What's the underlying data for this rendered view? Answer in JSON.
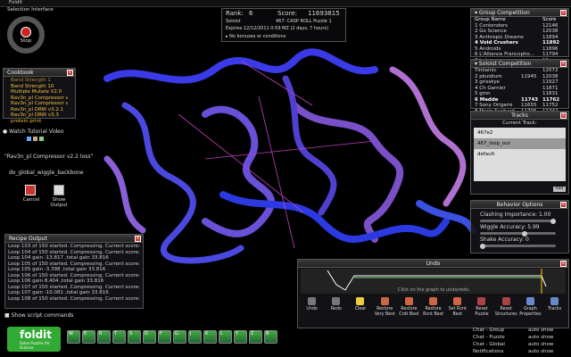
{
  "window_title": "Foldit",
  "selection": {
    "title": "Selection Interface",
    "stop_label": "Stop"
  },
  "score": {
    "rank_label": "Rank:",
    "rank_value": "6",
    "score_label": "Score:",
    "score_value": "11693815",
    "mode": "Soloist",
    "puzzle": "467: CASP ROLL Puzzle 1",
    "expires": "Expires 12/12/2011 0:59 MZ (2 days, 7 hours)",
    "conditions": "No bonuses or conditions"
  },
  "cookbook": {
    "title": "Cookbook",
    "items": [
      "Band Strength 1",
      "Band Strength 10",
      "Multiple Mutate V2.0",
      "Rav3n_pl Compressor v2.0",
      "Rav3n_pl Compressor v2.2 k",
      "Rav3n_pl DRW v3.2.1",
      "Rav3n_pl DRW v3.3",
      "protein print"
    ],
    "video": "Watch Tutorial Video",
    "running": "\"Rav3n_pl Compressor v2.2 loss\"",
    "command": "do_global_wiggle_backbone",
    "cancel": "Cancel",
    "show_output": "Show\nOutput"
  },
  "recipe_output": {
    "title": "Recipe Output",
    "lines": [
      "Loop 103 of 150 started. Compressing. Current score: 11762.9",
      "Loop 104 of 150 started. Compressing. Current score: 11762.9",
      "Loop 104 gain -13.817 ,total gain 33.816",
      "Loop 105 of 150 started. Compressing. Current score: 11762.9",
      "Loop 105 gain -3.398 ,total gain 33.816",
      "Loop 106 of 150 started. Compressing. Current score: 11762.9",
      "Loop 106 gain 8.404 ,total gain 33.816",
      "Loop 107 of 150 started. Compressing. Current score: 11753.0",
      "Loop 107 gain -10.081 ,total gain 33.816",
      "Loop 108 of 150 started. Compressing. Current score: 11753.0"
    ],
    "show_script": "Show script commands"
  },
  "group_comp": {
    "title": "Group Competition",
    "col1": "Group Name",
    "col2": "Score",
    "rows": [
      [
        "1 Contenders",
        "12146"
      ],
      [
        "2 Go Science",
        "12038"
      ],
      [
        "3 Anthropic Dreams",
        "11894"
      ],
      [
        "4 Void Crushers",
        "11892"
      ],
      [
        "5 Androids",
        "11896"
      ],
      [
        "6 L'Alliance Francopho...",
        "11794"
      ],
      [
        "7 beta...",
        "11xxx"
      ]
    ]
  },
  "solo_comp": {
    "title": "Soloist Competition",
    "rows": [
      [
        "Timlainic",
        "",
        "12072"
      ],
      [
        "2 pkuidium",
        "11945",
        "12038"
      ],
      [
        "3 grisskye",
        "",
        "11927"
      ],
      [
        "4 Ch Garnier",
        "",
        "11871"
      ],
      [
        "5 gmn",
        "",
        "11831"
      ],
      [
        "6 Madde",
        "11743",
        "11762"
      ],
      [
        "7 Sony Origami",
        "11655",
        "11752"
      ],
      [
        "8 Marie Suchard",
        "11705",
        "11742"
      ]
    ]
  },
  "tracks": {
    "title": "Tracks",
    "current_label": "Current Track:",
    "items": [
      "467e2",
      "467_loop_out",
      "default"
    ],
    "add_label": "Add"
  },
  "behavior": {
    "title": "Behavior Options",
    "clashing_label": "Clashing Importance: 1.00",
    "clashing_value": 1.0,
    "wiggle_label": "Wiggle Accuracy: 5.99",
    "wiggle_value": 0.6,
    "shake_label": "Shake Accuracy: 0",
    "shake_value": 0.0
  },
  "undo": {
    "title": "Undo",
    "hint": "Click on the graph to undo/redo.",
    "buttons": [
      "Undo",
      "Redo",
      "Clear",
      "Restore Very Best",
      "Restore Crdt Best",
      "Restore Rcnt Best",
      "Set Rcnt Best",
      "Reset Puzzle",
      "Reset Structures",
      "Graph Properties",
      "Tracks"
    ]
  },
  "toolbar": {
    "keys": [
      "W",
      "E",
      "R",
      "T",
      "S",
      "D",
      "F",
      "G",
      "J",
      "K",
      "L",
      "Y",
      "Z",
      "B"
    ]
  },
  "logo": {
    "name": "foldit",
    "tagline": "Solve Puzzles for Science"
  },
  "chat": {
    "items": [
      "Chat - Group",
      "Chat - Puzzle",
      "Chat - Global",
      "Notifications"
    ],
    "auto_show": "auto show"
  }
}
